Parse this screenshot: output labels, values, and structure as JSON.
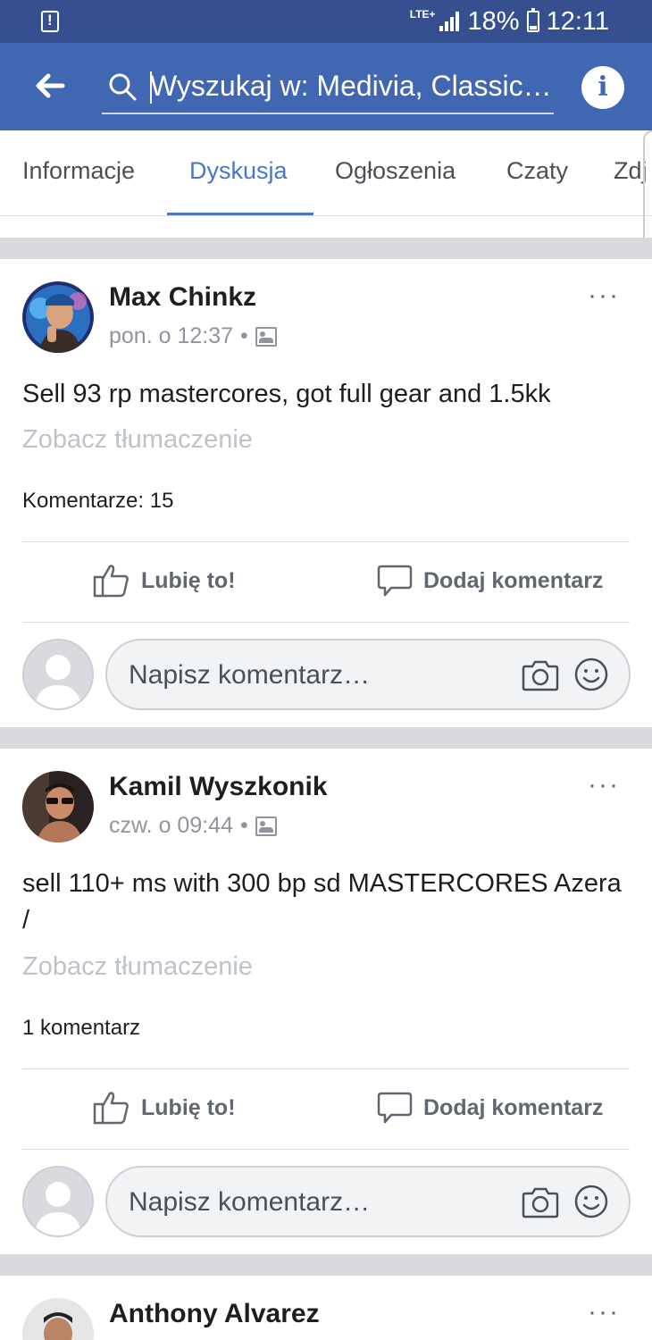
{
  "status_bar": {
    "network": "LTE+",
    "battery": "18%",
    "time": "12:11"
  },
  "app_bar": {
    "search_text": "Wyszukaj w: Medivia, Classic…"
  },
  "tabs": [
    "Informacje",
    "Dyskusja",
    "Ogłoszenia",
    "Czaty",
    "Zdj"
  ],
  "active_tab": "Dyskusja",
  "posts": [
    {
      "author": "Max Chinkz",
      "time": "pon. o 12:37",
      "text": "Sell 93 rp mastercores, got full gear and 1.5kk",
      "translate": "Zobacz tłumaczenie",
      "comments": "Komentarze: 15"
    },
    {
      "author": "Kamil Wyszkonik",
      "time": "czw. o 09:44",
      "text": "sell 110+ ms with 300 bp sd MASTERCORES Azera /",
      "translate": "Zobacz tłumaczenie",
      "comments": "1 komentarz"
    },
    {
      "author": "Anthony Alvarez"
    }
  ],
  "actions": {
    "like": "Lubię to!",
    "comment": "Dodaj komentarz"
  },
  "composer": {
    "placeholder": "Napisz komentarz…"
  },
  "meta_separator": "•",
  "more_menu": "···",
  "colors": {
    "app_bar": "#4267b2",
    "status_bar": "#36508f",
    "accent": "#4a76c8"
  }
}
